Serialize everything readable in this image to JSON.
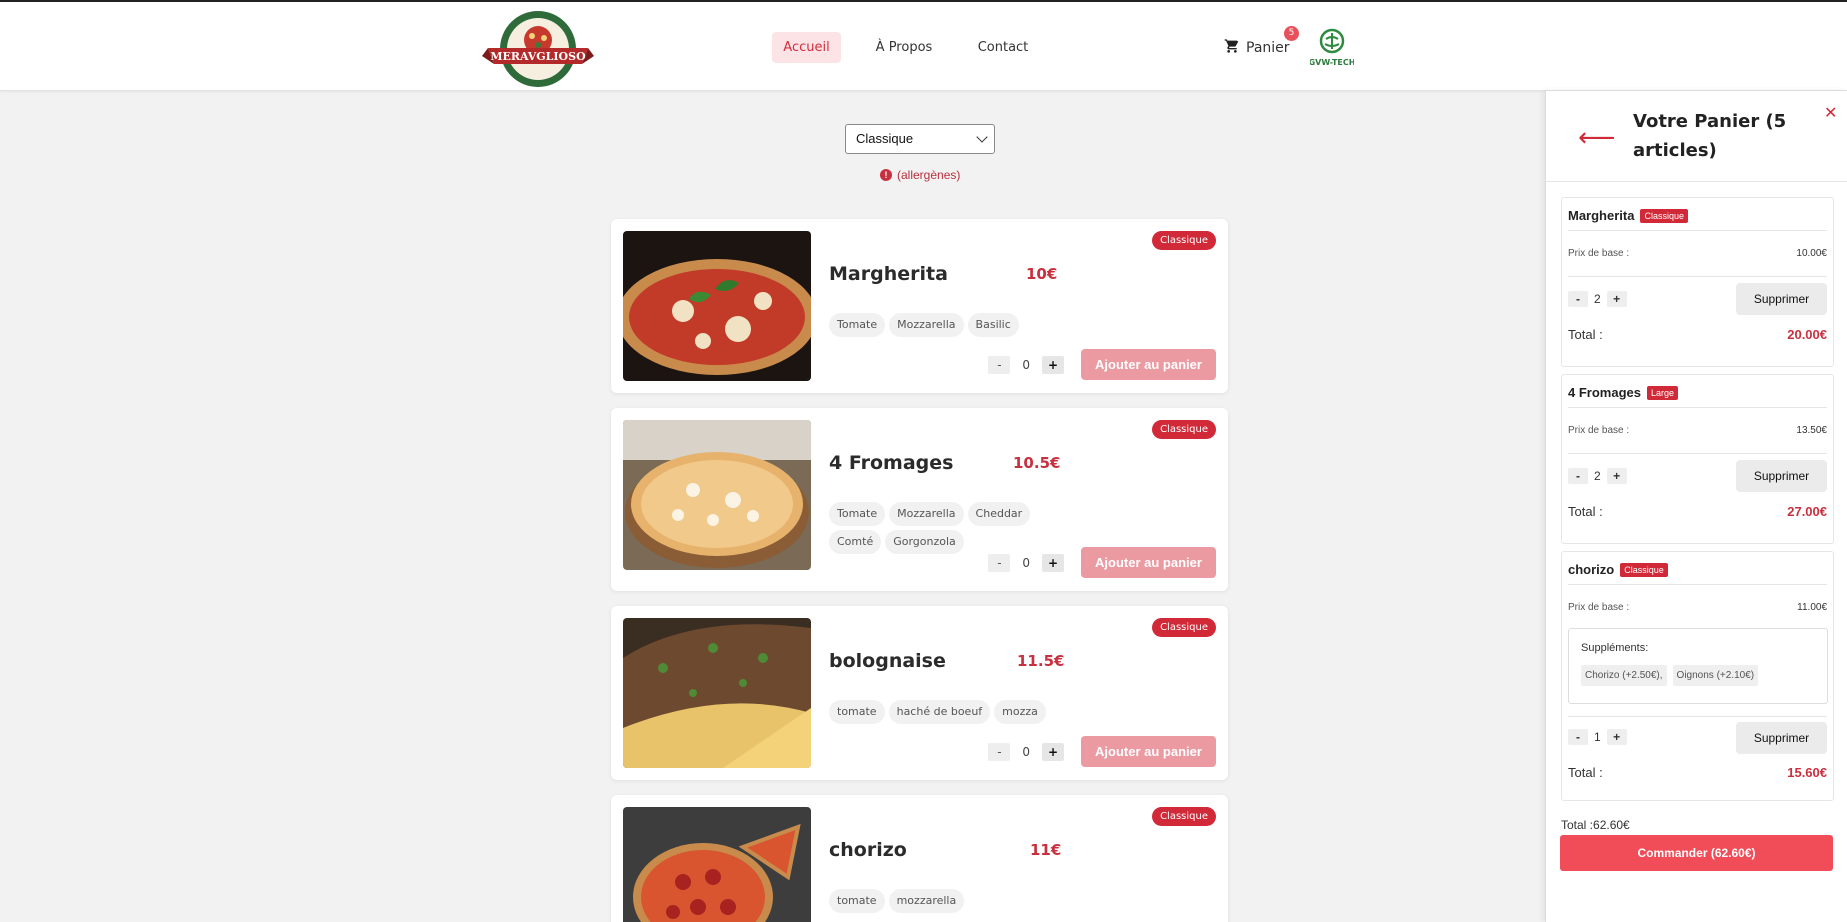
{
  "header": {
    "logo_text": "MERAVGLIOSO",
    "nav": [
      {
        "label": "Accueil",
        "active": true
      },
      {
        "label": "À Propos",
        "active": false
      },
      {
        "label": "Contact",
        "active": false
      }
    ],
    "cart_label": "Panier",
    "cart_count": "5",
    "partner_logo_text": "GVW-TECH"
  },
  "filter": {
    "selected": "Classique",
    "allergens_label": "(allergènes)"
  },
  "pizzas": [
    {
      "name": "Margherita",
      "price": "10€",
      "badge": "Classique",
      "ingredients": [
        "Tomate",
        "Mozzarella",
        "Basilic"
      ],
      "quantity": "0",
      "add_label": "Ajouter au panier"
    },
    {
      "name": "4 Fromages",
      "price": "10.5€",
      "badge": "Classique",
      "ingredients": [
        "Tomate",
        "Mozzarella",
        "Cheddar",
        "Comté",
        "Gorgonzola"
      ],
      "quantity": "0",
      "add_label": "Ajouter au panier"
    },
    {
      "name": "bolognaise",
      "price": "11.5€",
      "badge": "Classique",
      "ingredients": [
        "tomate",
        "haché de boeuf",
        "mozza"
      ],
      "quantity": "0",
      "add_label": "Ajouter au panier"
    },
    {
      "name": "chorizo",
      "price": "11€",
      "badge": "Classique",
      "ingredients": [
        "tomate",
        "mozzarella"
      ]
    }
  ],
  "cart": {
    "title": "Votre Panier (5 articles)",
    "items": [
      {
        "name": "Margherita",
        "size": "Classique",
        "base_label": "Prix de base :",
        "base_price": "10.00€",
        "quantity": "2",
        "delete_label": "Supprimer",
        "total_label": "Total :",
        "total": "20.00€"
      },
      {
        "name": "4 Fromages",
        "size": "Large",
        "base_label": "Prix de base :",
        "base_price": "13.50€",
        "quantity": "2",
        "delete_label": "Supprimer",
        "total_label": "Total :",
        "total": "27.00€"
      },
      {
        "name": "chorizo",
        "size": "Classique",
        "base_label": "Prix de base :",
        "base_price": "11.00€",
        "supplements_label": "Suppléments:",
        "supplements": [
          "Chorizo (+2.50€),",
          "Oignons (+2.10€)"
        ],
        "quantity": "1",
        "delete_label": "Supprimer",
        "total_label": "Total :",
        "total": "15.60€"
      }
    ],
    "grand_total": "Total :62.60€",
    "order_label": "Commander (62.60€)"
  },
  "colors": {
    "accent": "#d12937",
    "order_button": "#f04d58",
    "add_button": "#ec9aa2"
  }
}
